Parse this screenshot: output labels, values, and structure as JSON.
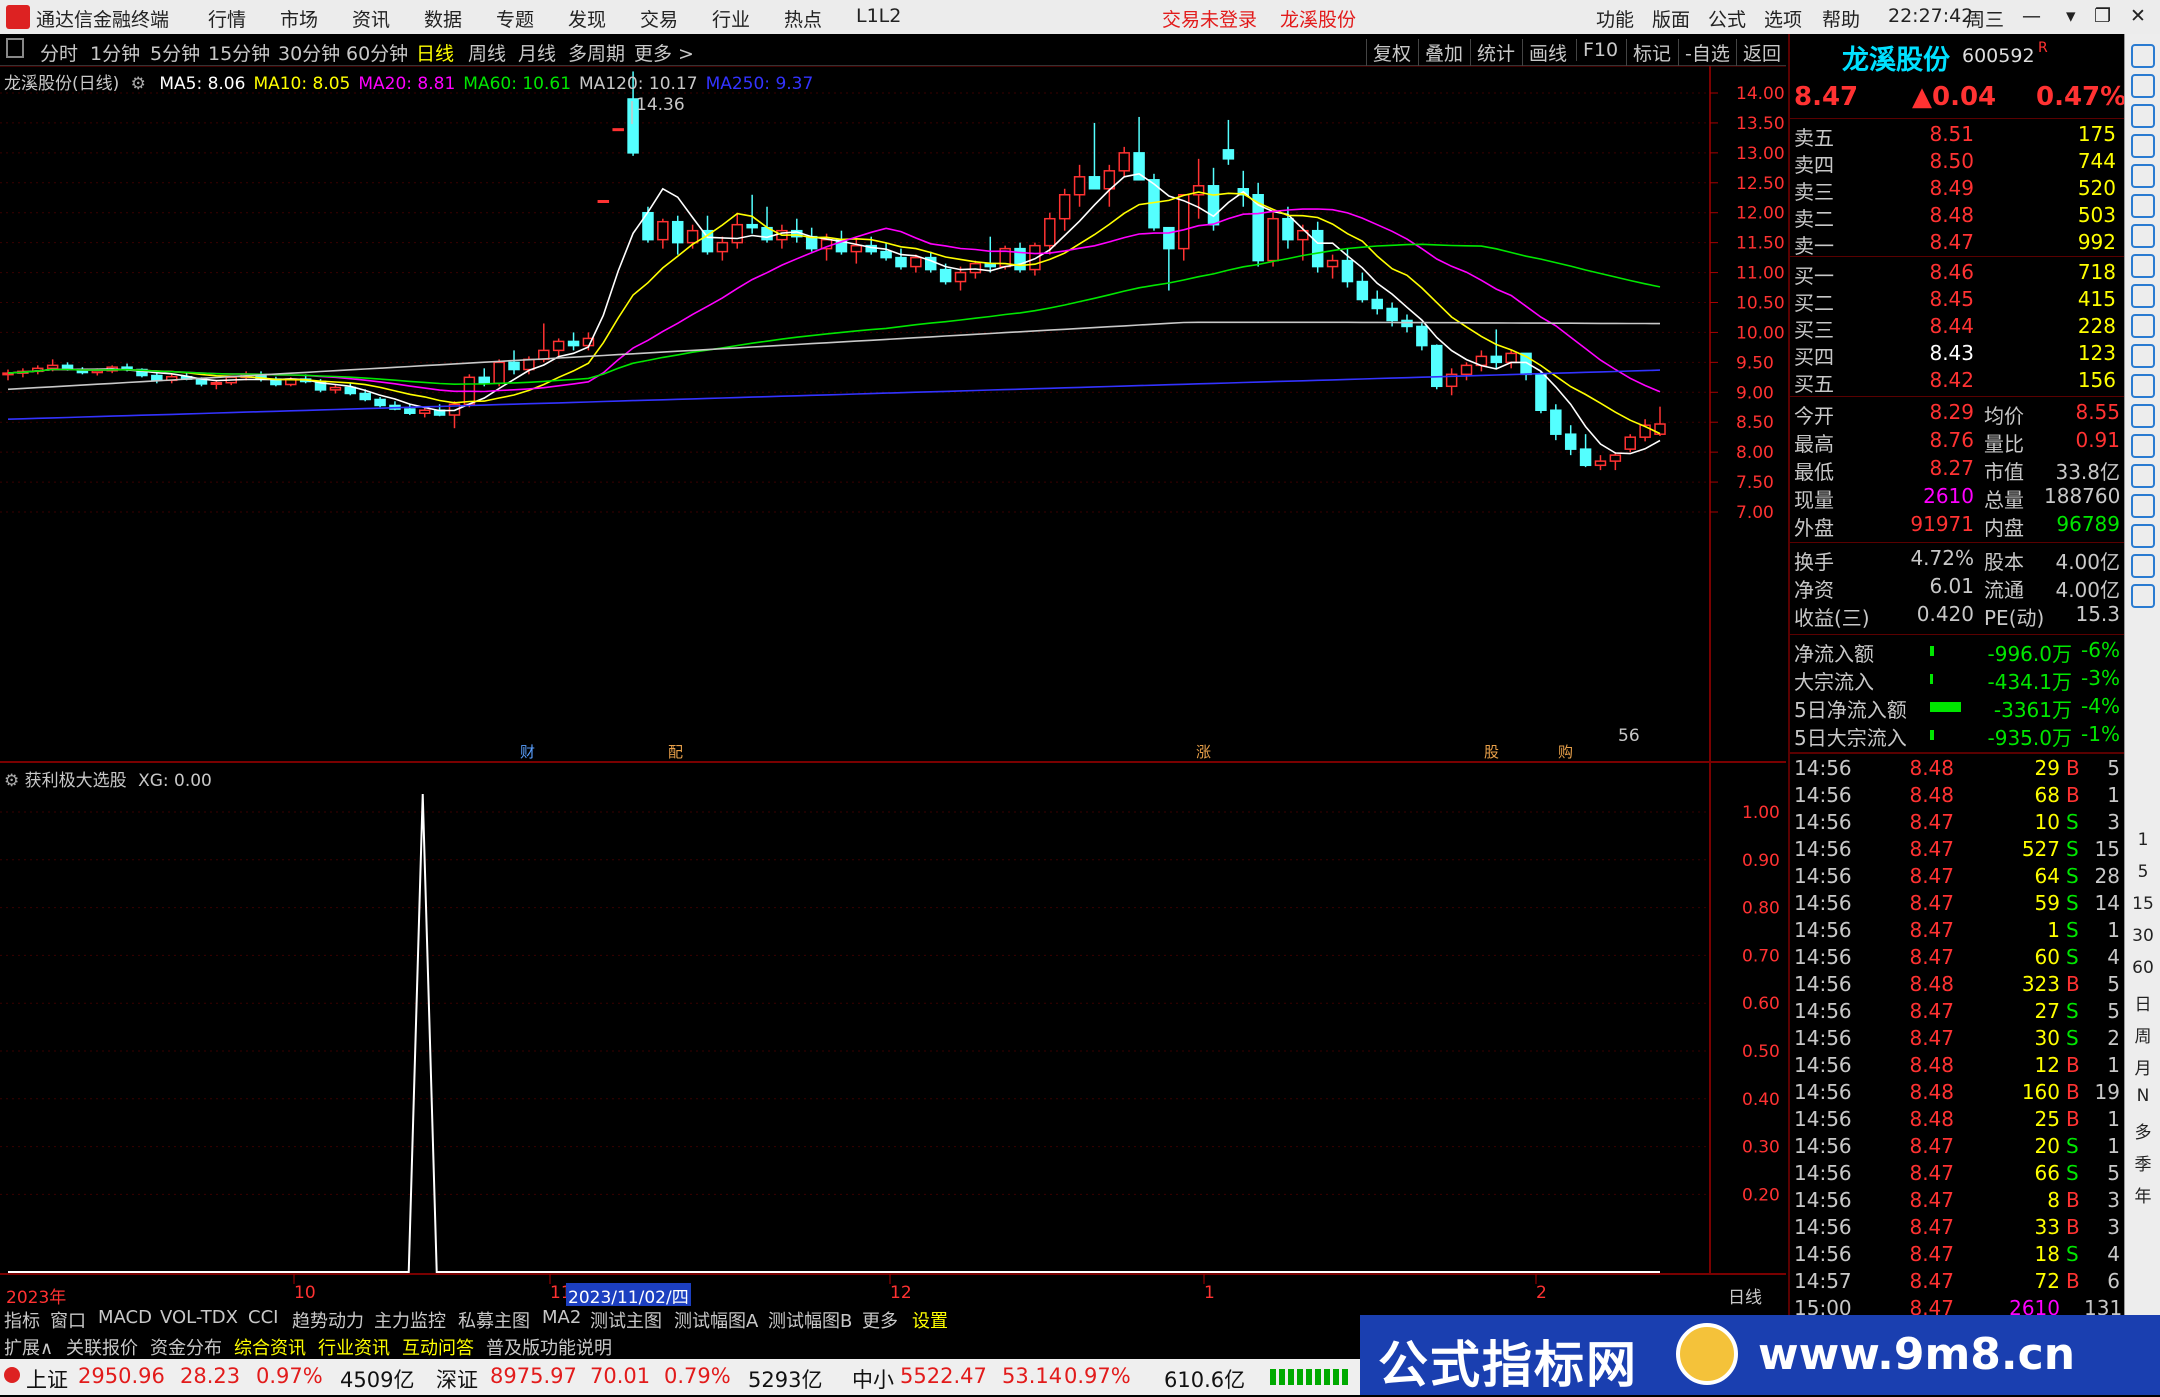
{
  "titlebar": {
    "app_name": "通达信金融终端",
    "menu": [
      "行情",
      "市场",
      "资讯",
      "数据",
      "专题",
      "发现",
      "交易",
      "行业",
      "热点",
      "L1L2"
    ],
    "trade_status": "交易未登录",
    "stock_name": "龙溪股份",
    "right_menu": [
      "功能",
      "版面",
      "公式",
      "选项",
      "帮助"
    ],
    "time": "22:27:42",
    "weekday": "周三"
  },
  "toolbar": {
    "periods": [
      "分时",
      "1分钟",
      "5分钟",
      "15分钟",
      "30分钟",
      "60分钟",
      "日线",
      "周线",
      "月线",
      "多周期",
      "更多 >"
    ],
    "active_period": "日线",
    "right_buttons": [
      "复权",
      "叠加",
      "统计",
      "画线",
      "F10",
      "标记",
      "-自选",
      "返回"
    ]
  },
  "main_chart": {
    "title": "龙溪股份(日线)",
    "ma_labels": [
      {
        "text": "MA5: 8.06",
        "color": "#ffffff"
      },
      {
        "text": "MA10: 8.05",
        "color": "#ffff00"
      },
      {
        "text": "MA20: 8.81",
        "color": "#ff00ff"
      },
      {
        "text": "MA60: 10.61",
        "color": "#00e600"
      },
      {
        "text": "MA120: 10.17",
        "color": "#c8c8c8"
      },
      {
        "text": "MA250: 9.37",
        "color": "#3333ff"
      }
    ],
    "y_ticks": [
      "14.00",
      "13.50",
      "13.00",
      "12.50",
      "12.00",
      "11.50",
      "11.00",
      "10.50",
      "10.00",
      "9.50",
      "9.00",
      "8.50",
      "8.00",
      "7.50",
      "7.00"
    ],
    "high_marker": "14.36",
    "event_tags": [
      "财",
      "配",
      "涨",
      "股",
      "购"
    ],
    "partial_label": "56"
  },
  "chart_data": {
    "type": "candlestick",
    "ma_series": [
      {
        "name": "MA5",
        "color": "#ffffff"
      },
      {
        "name": "MA10",
        "color": "#ffff00"
      },
      {
        "name": "MA20",
        "color": "#ff00ff"
      },
      {
        "name": "MA60",
        "color": "#00e600"
      },
      {
        "name": "MA120",
        "color": "#c8c8c8"
      },
      {
        "name": "MA250",
        "color": "#3333ff"
      }
    ],
    "ylim": [
      6.75,
      14.4
    ],
    "candles": [
      [
        9.3,
        9.38,
        9.2,
        9.32
      ],
      [
        9.32,
        9.4,
        9.25,
        9.35
      ],
      [
        9.35,
        9.45,
        9.3,
        9.4
      ],
      [
        9.4,
        9.55,
        9.35,
        9.45
      ],
      [
        9.45,
        9.5,
        9.36,
        9.38
      ],
      [
        9.38,
        9.42,
        9.3,
        9.33
      ],
      [
        9.33,
        9.4,
        9.28,
        9.36
      ],
      [
        9.36,
        9.45,
        9.32,
        9.42
      ],
      [
        9.42,
        9.48,
        9.35,
        9.38
      ],
      [
        9.38,
        9.4,
        9.25,
        9.28
      ],
      [
        9.28,
        9.32,
        9.15,
        9.2
      ],
      [
        9.2,
        9.3,
        9.15,
        9.26
      ],
      [
        9.26,
        9.32,
        9.2,
        9.22
      ],
      [
        9.22,
        9.25,
        9.1,
        9.14
      ],
      [
        9.14,
        9.2,
        9.05,
        9.16
      ],
      [
        9.16,
        9.28,
        9.12,
        9.25
      ],
      [
        9.25,
        9.35,
        9.2,
        9.3
      ],
      [
        9.3,
        9.35,
        9.18,
        9.22
      ],
      [
        9.22,
        9.26,
        9.1,
        9.13
      ],
      [
        9.13,
        9.25,
        9.1,
        9.22
      ],
      [
        9.22,
        9.3,
        9.15,
        9.18
      ],
      [
        9.18,
        9.22,
        9.0,
        9.04
      ],
      [
        9.04,
        9.12,
        8.98,
        9.08
      ],
      [
        9.08,
        9.15,
        8.95,
        8.98
      ],
      [
        8.98,
        9.05,
        8.85,
        8.88
      ],
      [
        8.88,
        8.92,
        8.75,
        8.78
      ],
      [
        8.78,
        8.85,
        8.7,
        8.72
      ],
      [
        8.72,
        8.8,
        8.62,
        8.65
      ],
      [
        8.65,
        8.75,
        8.58,
        8.7
      ],
      [
        8.7,
        8.8,
        8.6,
        8.62
      ],
      [
        8.62,
        8.85,
        8.4,
        8.8
      ],
      [
        8.8,
        9.3,
        8.75,
        9.25
      ],
      [
        9.25,
        9.4,
        9.1,
        9.15
      ],
      [
        9.15,
        9.55,
        9.1,
        9.5
      ],
      [
        9.5,
        9.7,
        9.3,
        9.38
      ],
      [
        9.38,
        9.6,
        9.3,
        9.55
      ],
      [
        9.55,
        10.15,
        9.5,
        9.7
      ],
      [
        9.7,
        9.9,
        9.6,
        9.85
      ],
      [
        9.85,
        10.0,
        9.7,
        9.78
      ],
      [
        9.78,
        10.0,
        9.7,
        9.9
      ],
      [
        12.2,
        12.2,
        12.2,
        12.2
      ],
      [
        13.4,
        13.4,
        13.4,
        13.4
      ],
      [
        13.9,
        14.36,
        12.95,
        13.0
      ],
      [
        12.0,
        12.1,
        11.5,
        11.55
      ],
      [
        11.55,
        11.9,
        11.4,
        11.85
      ],
      [
        11.85,
        11.95,
        11.3,
        11.5
      ],
      [
        11.5,
        11.8,
        11.4,
        11.7
      ],
      [
        11.7,
        11.95,
        11.3,
        11.35
      ],
      [
        11.35,
        11.6,
        11.2,
        11.5
      ],
      [
        11.5,
        12.0,
        11.4,
        11.8
      ],
      [
        11.8,
        12.3,
        11.65,
        11.75
      ],
      [
        11.75,
        12.1,
        11.5,
        11.55
      ],
      [
        11.55,
        11.8,
        11.4,
        11.7
      ],
      [
        11.7,
        11.9,
        11.5,
        11.6
      ],
      [
        11.6,
        11.75,
        11.35,
        11.4
      ],
      [
        11.4,
        11.65,
        11.2,
        11.55
      ],
      [
        11.55,
        11.7,
        11.3,
        11.35
      ],
      [
        11.35,
        11.55,
        11.15,
        11.45
      ],
      [
        11.45,
        11.6,
        11.3,
        11.35
      ],
      [
        11.35,
        11.5,
        11.2,
        11.25
      ],
      [
        11.25,
        11.4,
        11.05,
        11.1
      ],
      [
        11.1,
        11.3,
        11.0,
        11.25
      ],
      [
        11.25,
        11.35,
        11.0,
        11.05
      ],
      [
        11.05,
        11.15,
        10.8,
        10.85
      ],
      [
        10.85,
        11.1,
        10.7,
        11.0
      ],
      [
        11.0,
        11.2,
        10.9,
        11.15
      ],
      [
        11.15,
        11.6,
        11.0,
        11.1
      ],
      [
        11.1,
        11.45,
        11.05,
        11.4
      ],
      [
        11.4,
        11.5,
        11.0,
        11.05
      ],
      [
        11.05,
        11.5,
        10.95,
        11.45
      ],
      [
        11.45,
        12.0,
        11.3,
        11.9
      ],
      [
        11.9,
        12.4,
        11.7,
        12.3
      ],
      [
        12.3,
        12.8,
        12.1,
        12.6
      ],
      [
        12.6,
        13.5,
        12.5,
        12.4
      ],
      [
        12.4,
        12.8,
        12.1,
        12.7
      ],
      [
        12.7,
        13.1,
        12.6,
        13.0
      ],
      [
        13.0,
        13.6,
        12.6,
        12.55
      ],
      [
        12.55,
        12.65,
        11.7,
        11.75
      ],
      [
        11.75,
        11.7,
        10.7,
        11.4
      ],
      [
        11.4,
        12.0,
        11.2,
        12.3
      ],
      [
        12.3,
        12.9,
        11.9,
        12.45
      ],
      [
        12.45,
        12.75,
        11.7,
        11.8
      ],
      [
        13.05,
        13.55,
        12.8,
        12.9
      ],
      [
        12.4,
        12.7,
        12.1,
        12.3
      ],
      [
        12.3,
        12.5,
        11.1,
        11.2
      ],
      [
        11.2,
        12.0,
        11.1,
        11.9
      ],
      [
        11.9,
        12.1,
        11.4,
        11.55
      ],
      [
        11.55,
        11.8,
        11.2,
        11.7
      ],
      [
        11.7,
        11.85,
        11.0,
        11.1
      ],
      [
        11.1,
        11.3,
        10.9,
        11.2
      ],
      [
        11.2,
        11.4,
        10.75,
        10.85
      ],
      [
        10.85,
        11.0,
        10.5,
        10.55
      ],
      [
        10.55,
        10.7,
        10.3,
        10.4
      ],
      [
        10.4,
        10.5,
        10.1,
        10.2
      ],
      [
        10.2,
        10.3,
        10.0,
        10.1
      ],
      [
        10.1,
        10.15,
        9.7,
        9.78
      ],
      [
        9.78,
        9.8,
        9.05,
        9.1
      ],
      [
        9.1,
        9.4,
        8.95,
        9.3
      ],
      [
        9.3,
        9.5,
        9.2,
        9.45
      ],
      [
        9.45,
        9.7,
        9.35,
        9.6
      ],
      [
        9.6,
        10.05,
        9.4,
        9.5
      ],
      [
        9.5,
        9.7,
        9.4,
        9.65
      ],
      [
        9.65,
        9.6,
        9.2,
        9.3
      ],
      [
        9.3,
        9.35,
        8.65,
        8.7
      ],
      [
        8.7,
        8.8,
        8.2,
        8.3
      ],
      [
        8.3,
        8.45,
        7.95,
        8.05
      ],
      [
        8.05,
        8.3,
        7.75,
        7.78
      ],
      [
        7.78,
        7.95,
        7.7,
        7.85
      ],
      [
        7.85,
        8.0,
        7.7,
        7.95
      ],
      [
        8.05,
        8.3,
        8.0,
        8.25
      ],
      [
        8.25,
        8.55,
        8.18,
        8.45
      ],
      [
        8.3,
        8.76,
        8.27,
        8.47
      ]
    ]
  },
  "indicator": {
    "title": "获利极大选股",
    "value_label": "XG: 0.00",
    "y_ticks": [
      "1.00",
      "0.90",
      "0.80",
      "0.70",
      "0.60",
      "0.50",
      "0.40",
      "0.30",
      "0.20"
    ]
  },
  "indicator_data": {
    "type": "line",
    "spike_index": 28,
    "values_note": "0 except spike=1"
  },
  "time_axis": {
    "labels": [
      "2023年",
      "10",
      "11",
      "2023/11/02/四",
      "12",
      "1",
      "2"
    ],
    "period_label": "日线"
  },
  "tabs_row1": [
    "指标",
    "窗口",
    "MACD",
    "VOL-TDX",
    "CCI",
    "趋势动力",
    "主力监控",
    "私募主图",
    "MA2",
    "测试主图",
    "测试幅图A",
    "测试幅图B",
    "更多",
    "设置"
  ],
  "tabs_row2": [
    "扩展∧",
    "关联报价",
    "资金分布",
    "综合资讯",
    "行业资讯",
    "互动问答",
    "普及版功能说明"
  ],
  "quote": {
    "name": "龙溪股份",
    "code": "600592",
    "flag": "R",
    "price": "8.47",
    "change": "▲0.04",
    "change_pct": "0.47%",
    "asks": [
      {
        "label": "卖五",
        "price": "8.51",
        "vol": "175"
      },
      {
        "label": "卖四",
        "price": "8.50",
        "vol": "744"
      },
      {
        "label": "卖三",
        "price": "8.49",
        "vol": "520"
      },
      {
        "label": "卖二",
        "price": "8.48",
        "vol": "503"
      },
      {
        "label": "卖一",
        "price": "8.47",
        "vol": "992"
      }
    ],
    "bids": [
      {
        "label": "买一",
        "price": "8.46",
        "vol": "718"
      },
      {
        "label": "买二",
        "price": "8.45",
        "vol": "415"
      },
      {
        "label": "买三",
        "price": "8.44",
        "vol": "228"
      },
      {
        "label": "买四",
        "price": "8.43",
        "vol": "123"
      },
      {
        "label": "买五",
        "price": "8.42",
        "vol": "156"
      }
    ],
    "stats": [
      [
        "今开",
        "8.29",
        "均价",
        "8.55"
      ],
      [
        "最高",
        "8.76",
        "量比",
        "0.91"
      ],
      [
        "最低",
        "8.27",
        "市值",
        "33.8亿"
      ],
      [
        "现量",
        "2610",
        "总量",
        "188760"
      ],
      [
        "外盘",
        "91971",
        "内盘",
        "96789"
      ],
      [
        "换手",
        "4.72%",
        "股本",
        "4.00亿"
      ],
      [
        "净资",
        "6.01",
        "流通",
        "4.00亿"
      ],
      [
        "收益(三)",
        "0.420",
        "PE(动)",
        "15.3"
      ]
    ],
    "flows": [
      {
        "label": "净流入额",
        "value": "-996.0万",
        "pct": "-6%",
        "bar": 0.1
      },
      {
        "label": "大宗流入",
        "value": "-434.1万",
        "pct": "-3%",
        "bar": 0.04
      },
      {
        "label": "5日净流入额",
        "value": "-3361万",
        "pct": "-4%",
        "bar": 0.85
      },
      {
        "label": "5日大宗流入",
        "value": "-935.0万",
        "pct": "-1%",
        "bar": 0.1
      }
    ],
    "ticks": [
      [
        "14:56",
        "8.48",
        "29",
        "B",
        "5"
      ],
      [
        "14:56",
        "8.48",
        "68",
        "B",
        "1"
      ],
      [
        "14:56",
        "8.47",
        "10",
        "S",
        "3"
      ],
      [
        "14:56",
        "8.47",
        "527",
        "S",
        "15"
      ],
      [
        "14:56",
        "8.47",
        "64",
        "S",
        "28"
      ],
      [
        "14:56",
        "8.47",
        "59",
        "S",
        "14"
      ],
      [
        "14:56",
        "8.47",
        "1",
        "S",
        "1"
      ],
      [
        "14:56",
        "8.47",
        "60",
        "S",
        "4"
      ],
      [
        "14:56",
        "8.48",
        "323",
        "B",
        "5"
      ],
      [
        "14:56",
        "8.47",
        "27",
        "S",
        "5"
      ],
      [
        "14:56",
        "8.47",
        "30",
        "S",
        "2"
      ],
      [
        "14:56",
        "8.48",
        "12",
        "B",
        "1"
      ],
      [
        "14:56",
        "8.48",
        "160",
        "B",
        "19"
      ],
      [
        "14:56",
        "8.48",
        "25",
        "B",
        "1"
      ],
      [
        "14:56",
        "8.47",
        "20",
        "S",
        "1"
      ],
      [
        "14:56",
        "8.47",
        "66",
        "S",
        "5"
      ],
      [
        "14:56",
        "8.47",
        "8",
        "B",
        "3"
      ],
      [
        "14:56",
        "8.47",
        "33",
        "B",
        "3"
      ],
      [
        "14:56",
        "8.47",
        "18",
        "S",
        "4"
      ],
      [
        "14:57",
        "8.47",
        "72",
        "B",
        "6"
      ],
      [
        "15:00",
        "8.47",
        "2610",
        "",
        "131"
      ]
    ]
  },
  "sidebar": {
    "icons": [
      "up-arrow-icon",
      "up-icon",
      "down-icon",
      "book-icon",
      "chart-icon",
      "list-icon",
      "trend-icon",
      "candle-icon",
      "table-icon",
      "f10-icon",
      "grid-icon",
      "list2-icon",
      "f2-icon",
      "circle-icon",
      "rsi-icon",
      "move-icon",
      "pen-icon",
      "fs-icon",
      "block-icon"
    ],
    "labels": [
      "1",
      "5",
      "15",
      "30",
      "60",
      "日",
      "周",
      "月",
      "N",
      "多",
      "季",
      "年"
    ]
  },
  "statusbar": {
    "items": [
      {
        "name": "上证",
        "value": "2950.96",
        "chg": "28.23",
        "pct": "0.97%",
        "amt": "4509亿"
      },
      {
        "name": "深证",
        "value": "8975.97",
        "chg": "70.01",
        "pct": "0.79%",
        "amt": "5293亿"
      },
      {
        "name": "中小",
        "value": "5522.47",
        "chg": "53.14",
        "pct": "0.97%",
        "amt": "610.6亿"
      }
    ]
  },
  "banner": {
    "text": "公式指标网",
    "url": "www.9m8.cn"
  }
}
